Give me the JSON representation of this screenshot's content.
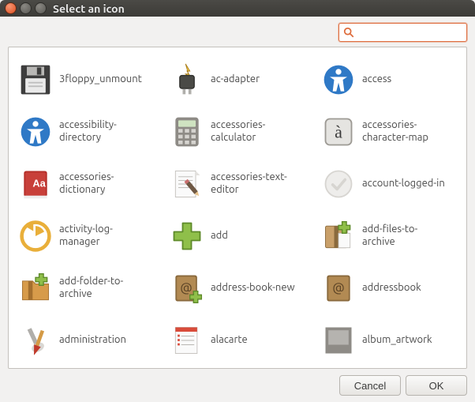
{
  "window": {
    "title": "Select an icon"
  },
  "search": {
    "value": "",
    "placeholder": ""
  },
  "icons": [
    {
      "id": "3floppy_unmount",
      "label": "3floppy_unmount"
    },
    {
      "id": "ac-adapter",
      "label": "ac-adapter"
    },
    {
      "id": "access",
      "label": "access"
    },
    {
      "id": "accessibility-directory",
      "label": "accessibility-directory"
    },
    {
      "id": "accessories-calculator",
      "label": "accessories-calculator"
    },
    {
      "id": "accessories-character-map",
      "label": "accessories-character-map"
    },
    {
      "id": "accessories-dictionary",
      "label": "accessories-dictionary"
    },
    {
      "id": "accessories-text-editor",
      "label": "accessories-text-editor"
    },
    {
      "id": "account-logged-in",
      "label": "account-logged-in"
    },
    {
      "id": "activity-log-manager",
      "label": "activity-log-manager"
    },
    {
      "id": "add",
      "label": "add"
    },
    {
      "id": "add-files-to-archive",
      "label": "add-files-to-archive"
    },
    {
      "id": "add-folder-to-archive",
      "label": "add-folder-to-archive"
    },
    {
      "id": "address-book-new",
      "label": "address-book-new"
    },
    {
      "id": "addressbook",
      "label": "addressbook"
    },
    {
      "id": "administration",
      "label": "administration"
    },
    {
      "id": "alacarte",
      "label": "alacarte"
    },
    {
      "id": "album_artwork",
      "label": "album_artwork"
    }
  ],
  "buttons": {
    "cancel": "Cancel",
    "ok": "OK"
  }
}
